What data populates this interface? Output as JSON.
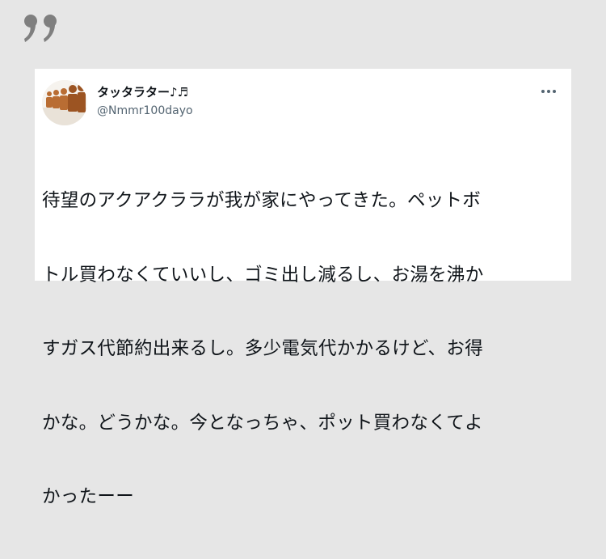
{
  "embed": {
    "quote_icon": "quotation-mark-icon",
    "accent_color": "#7f7f7f"
  },
  "tweet": {
    "display_name": "タッタラター♪♬",
    "handle": "@Nmmr100dayo",
    "avatar_icon": "avatar-figures-image",
    "more_icon": "more-options-icon",
    "text_lines": [
      "待望のアクアクララが我が家にやってきた。ペットボ",
      "トル買わなくていいし、ゴミ出し減るし、お湯を沸か",
      "すガス代節約出来るし。多少電気代かかるけど、お得",
      "かな。どうかな。今となっちゃ、ポット買わなくてよ",
      "かったーー"
    ]
  }
}
